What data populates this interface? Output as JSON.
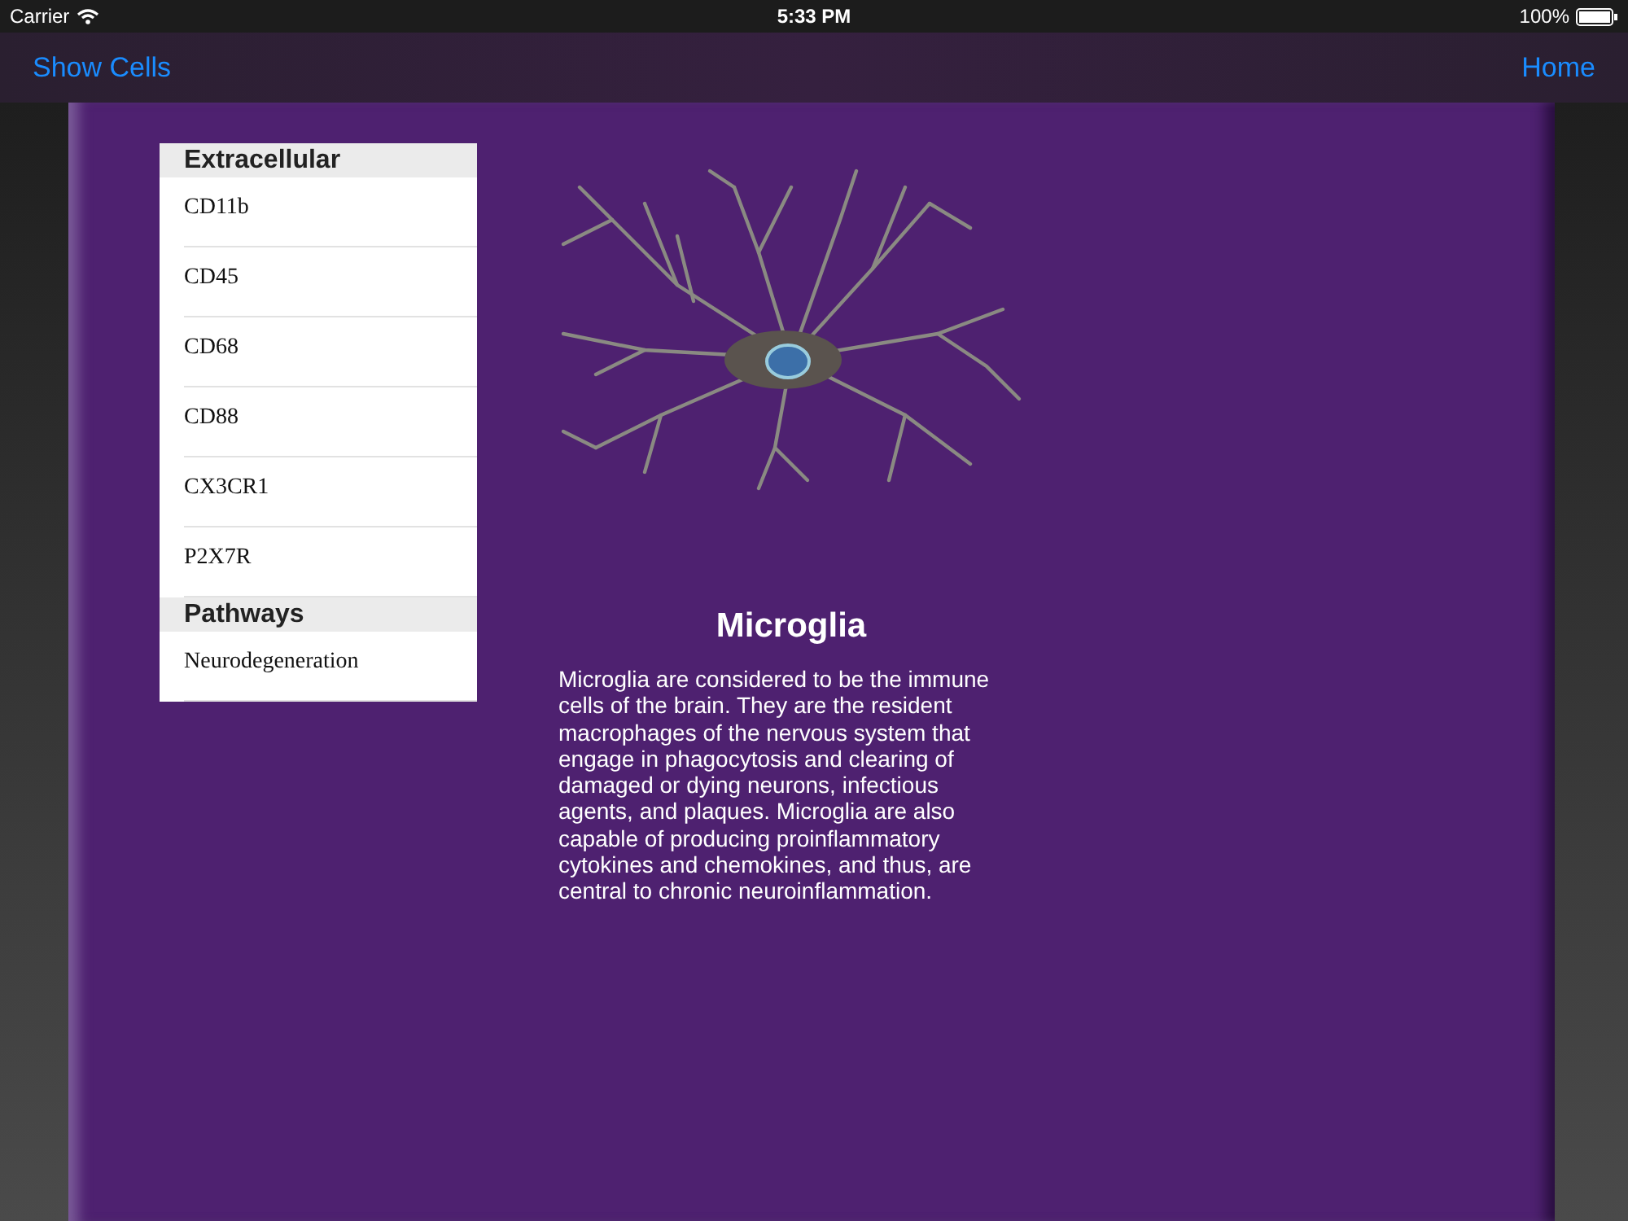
{
  "status_bar": {
    "carrier": "Carrier",
    "time": "5:33 PM",
    "battery": "100%"
  },
  "nav": {
    "left": "Show Cells",
    "right": "Home"
  },
  "sections": [
    {
      "header": "Extracellular",
      "items": [
        "CD11b",
        "CD45",
        "CD68",
        "CD88",
        "CX3CR1",
        "P2X7R"
      ]
    },
    {
      "header": "Pathways",
      "items": [
        "Neurodegeneration"
      ]
    }
  ],
  "detail": {
    "title": "Microglia",
    "description": "Microglia are considered to be the immune cells of the brain. They are the resident macrophages of the nervous system that engage in phagocytosis and clearing of damaged or dying neurons, infectious agents, and plaques. Microglia are also capable of producing proinflammatory cytokines and chemokines, and thus, are central to chronic neuroinflammation."
  }
}
